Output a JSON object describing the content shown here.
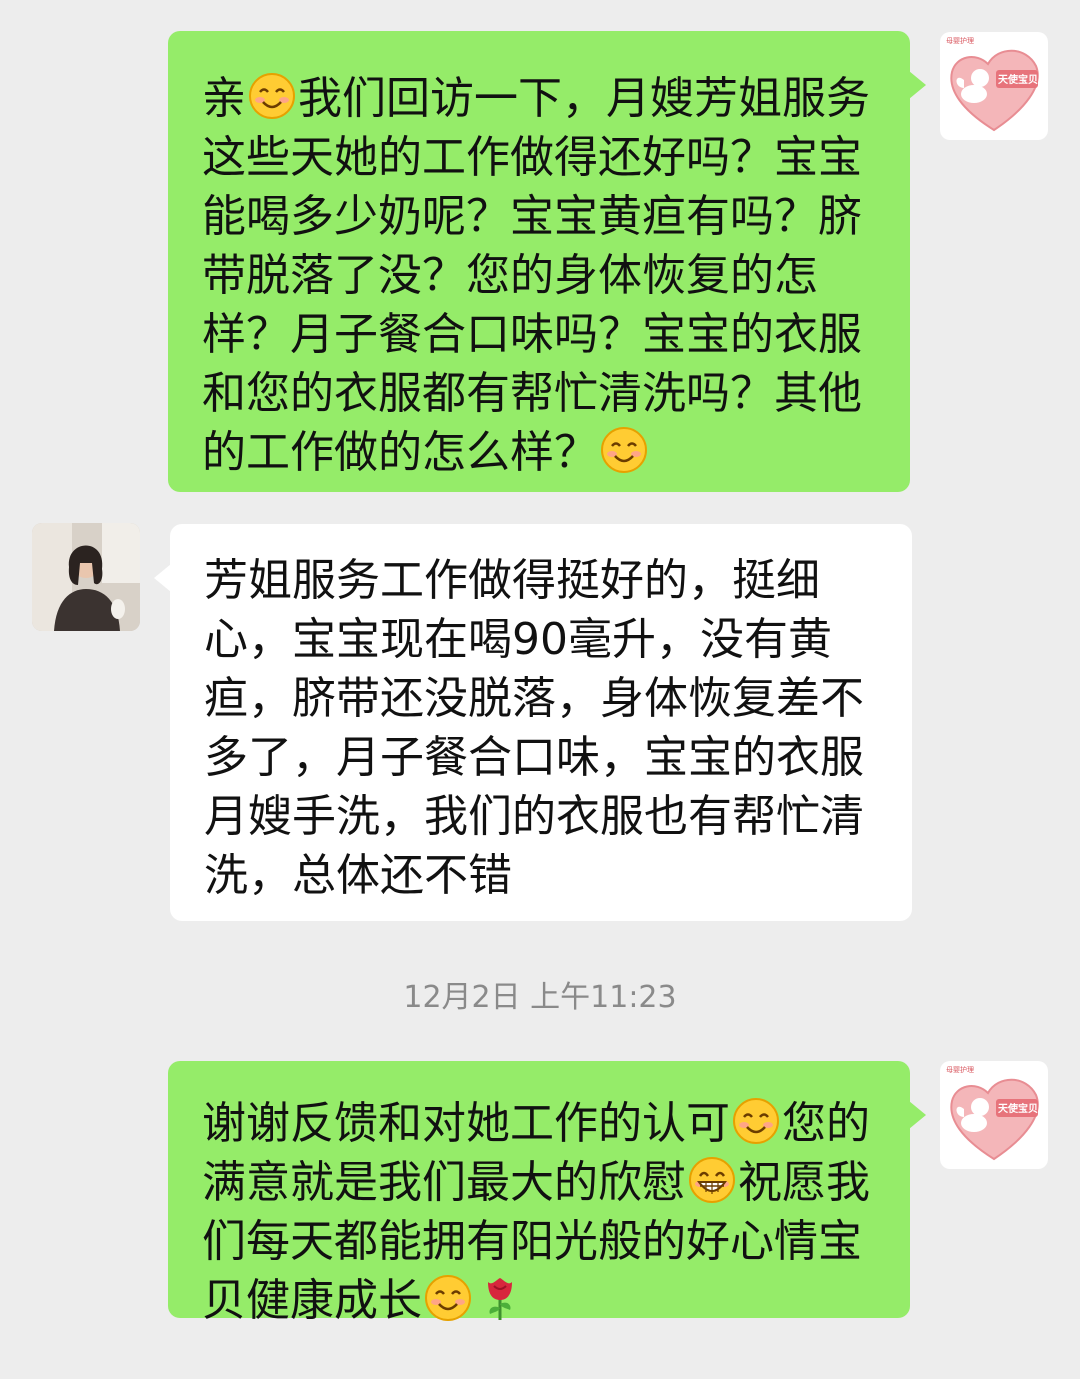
{
  "messages": [
    {
      "side": "right",
      "avatar_icon": "heart-angel-logo-icon",
      "logo_text_top": "母婴护理",
      "logo_text_main": "天使宝贝",
      "segments": [
        {
          "text": "亲"
        },
        {
          "emoji": "smile-emoji-icon"
        },
        {
          "text": "我们回访一下，月嫂芳姐服务这些天她的工作做得还好吗？宝宝能喝多少奶呢？宝宝黄疸有吗？脐带脱落了没？您的身体恢复的怎样？月子餐合口味吗？宝宝的衣服和您的衣服都有帮忙清洗吗？其他的工作做的怎么样？"
        },
        {
          "emoji": "smile-emoji-icon"
        }
      ]
    },
    {
      "side": "left",
      "avatar_icon": "user-photo-avatar",
      "segments": [
        {
          "text": "芳姐服务工作做得挺好的，挺细心，宝宝现在喝90毫升，没有黄疸，脐带还没脱落，身体恢复差不多了，月子餐合口味，宝宝的衣服月嫂手洗，我们的衣服也有帮忙清洗，总体还不错"
        }
      ]
    },
    {
      "side": "right",
      "avatar_icon": "heart-angel-logo-icon",
      "logo_text_top": "母婴护理",
      "logo_text_main": "天使宝贝",
      "segments": [
        {
          "text": "谢谢反馈和对她工作的认可"
        },
        {
          "emoji": "smile-emoji-icon"
        },
        {
          "text": "您的满意就是我们最大的欣慰"
        },
        {
          "emoji": "grin-emoji-icon"
        },
        {
          "text": "祝愿我们每天都能拥有阳光般的好心情宝贝健康成长"
        },
        {
          "emoji": "smile-emoji-icon"
        },
        {
          "emoji": "rose-emoji-icon"
        }
      ]
    }
  ],
  "timestamp": "12月2日 上午11:23",
  "colors": {
    "background": "#ededed",
    "outgoing_bubble": "#95ec69",
    "incoming_bubble": "#ffffff",
    "timestamp_text": "#8a8a8a",
    "logo_heart": "#f4b6b9"
  }
}
